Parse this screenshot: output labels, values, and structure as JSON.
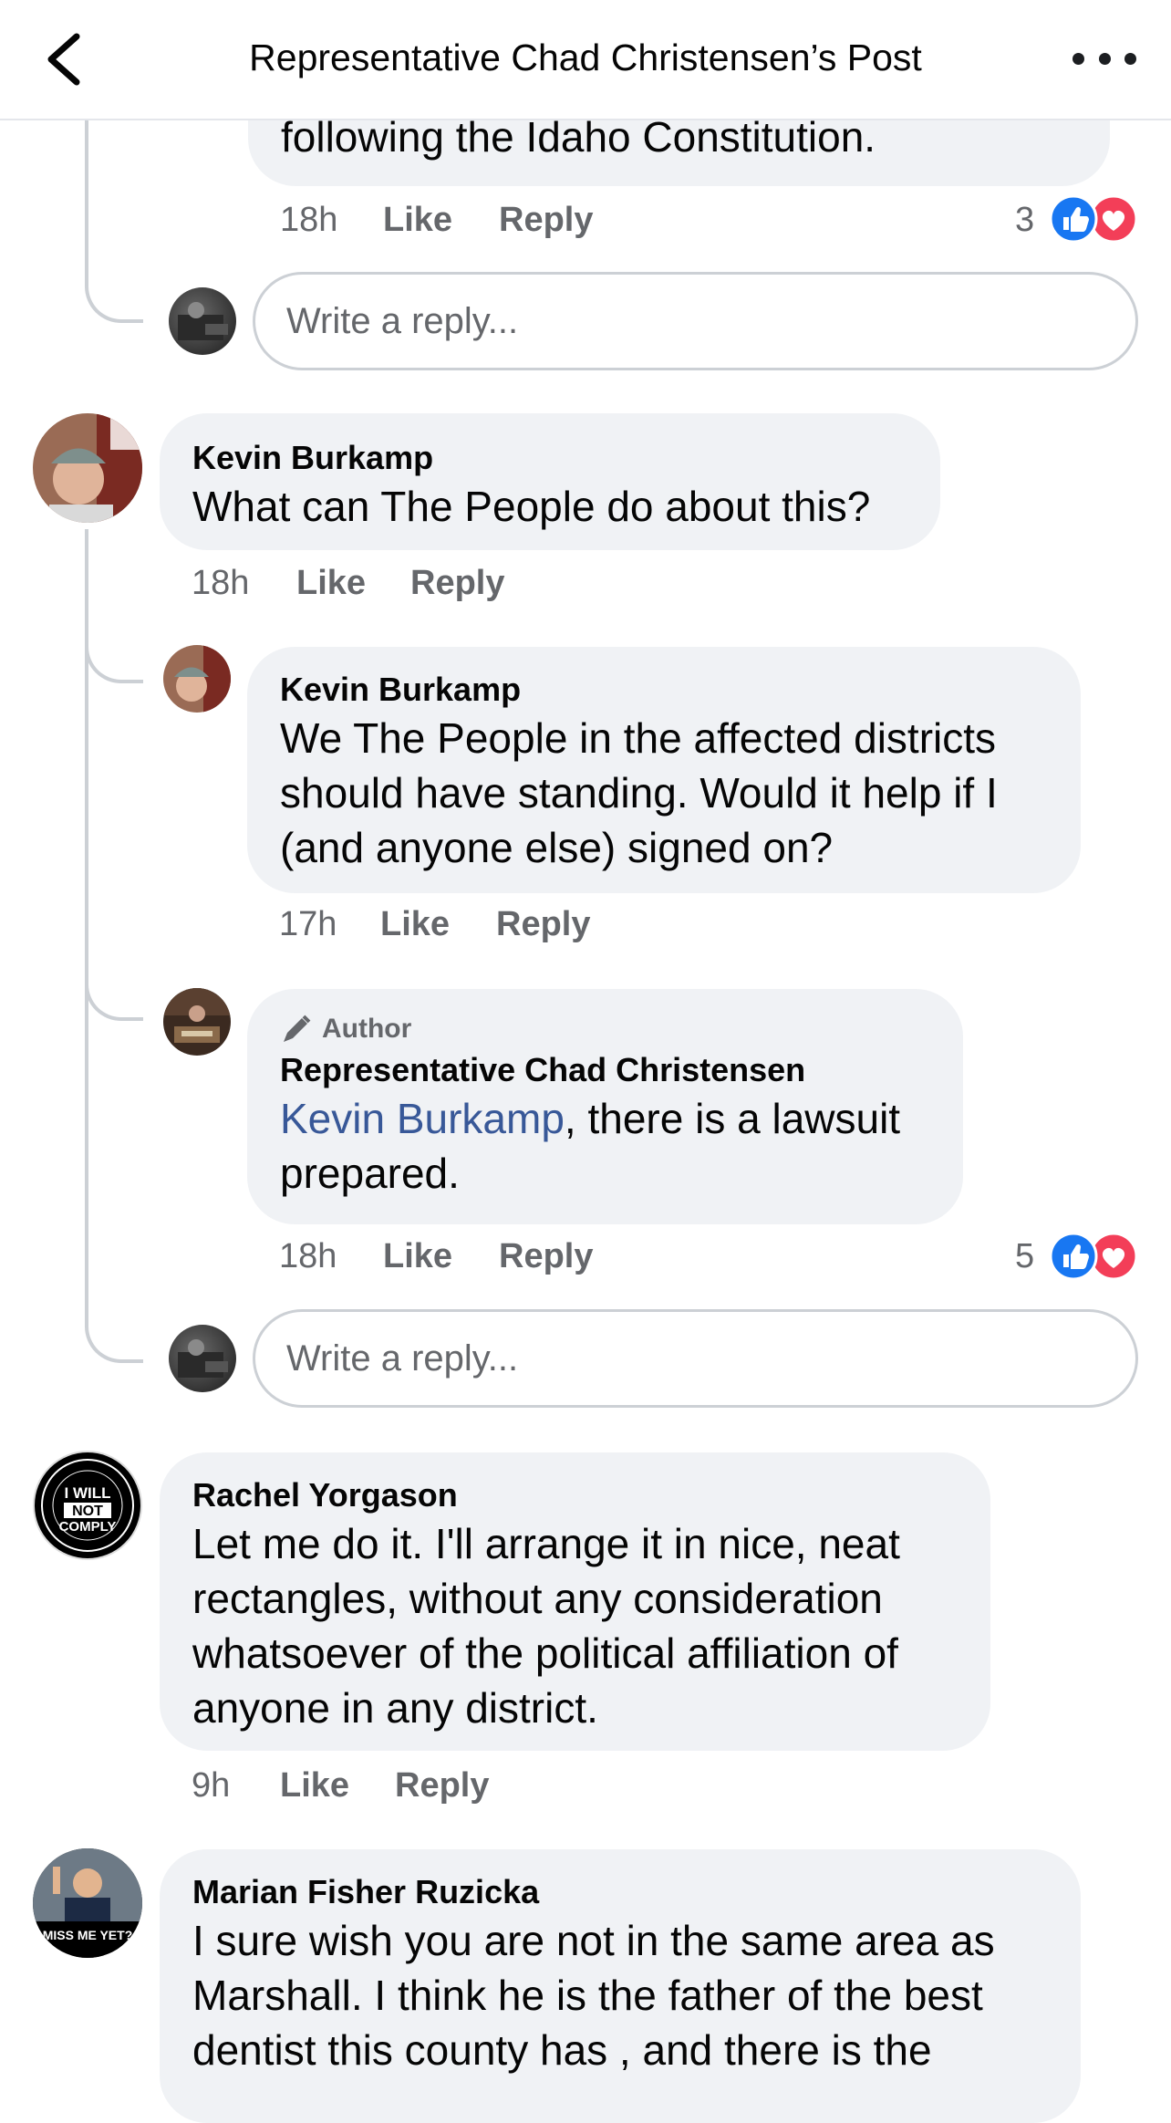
{
  "header": {
    "title": "Representative Chad Christensen’s Post"
  },
  "comments": [
    {
      "text": "following the Idaho Constitution.",
      "time": "18h",
      "like": "Like",
      "reply": "Reply",
      "reaction_count": "3"
    },
    {
      "reply_placeholder": "Write a reply..."
    },
    {
      "author": "Kevin Burkamp",
      "text": "What can The People do about this?",
      "time": "18h",
      "like": "Like",
      "reply": "Reply"
    },
    {
      "author": "Kevin Burkamp",
      "text": "We The People in the affected districts should have standing. Would it help if I (and anyone else) signed on?",
      "time": "17h",
      "like": "Like",
      "reply": "Reply"
    },
    {
      "badge": "Author",
      "author": "Representative Chad Christensen",
      "mention": "Kevin Burkamp",
      "text": ", there is a lawsuit prepared.",
      "time": "18h",
      "like": "Like",
      "reply": "Reply",
      "reaction_count": "5"
    },
    {
      "reply_placeholder": "Write a reply..."
    },
    {
      "author": "Rachel Yorgason",
      "text": "Let me do it. I'll arrange it in nice, neat rectangles, without any consideration whatsoever of the political affiliation of anyone in any district.",
      "time": "9h",
      "like": "Like",
      "reply": "Reply",
      "avatar_text": [
        "I WILL",
        "NOT",
        "COMPLY"
      ]
    },
    {
      "author": "Marian Fisher Ruzicka",
      "text": "I sure wish you are not in the same area as Marshall.  I think he is the father of the best dentist this county has , and there is the",
      "avatar_text": "MISS ME YET?"
    }
  ],
  "colors": {
    "like_blue": "#1877f2",
    "love_red": "#f33e58",
    "mention_blue": "#385898",
    "bubble_bg": "#f0f2f5"
  },
  "icons": [
    "back-chevron-icon",
    "more-icon",
    "like-reaction-icon",
    "love-reaction-icon",
    "pencil-icon"
  ]
}
